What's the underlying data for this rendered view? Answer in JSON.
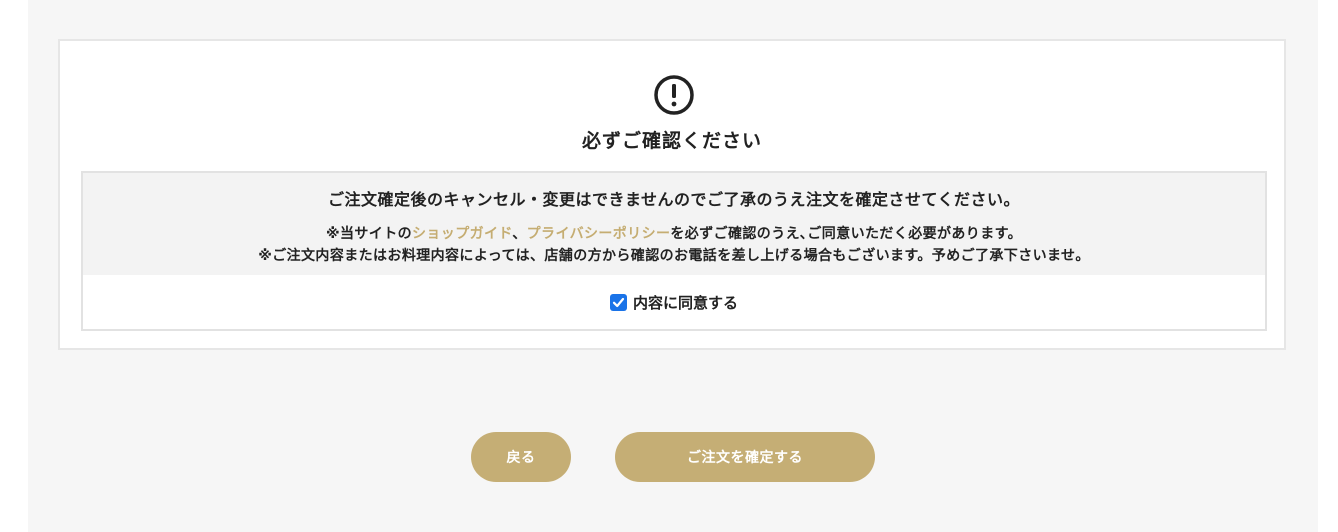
{
  "notice": {
    "icon": "exclamation-circle-icon",
    "title": "必ずご確認ください",
    "main_warning": "ご注文確定後のキャンセル・変更はできませんのでご了承のうえ注文を確定させてください。",
    "line1": {
      "prefix": "※当サイトの",
      "link1": "ショップガイド",
      "separator": "、",
      "link2": "プライバシーポリシー",
      "suffix": "を必ずご確認のうえ､ご同意いただく必要があります。"
    },
    "line2": "※ご注文内容またはお料理内容によっては、店舗の方から確認のお電話を差し上げる場合もございます。予めご了承下さいませ。",
    "agree_label": "内容に同意する",
    "agree_checked": true
  },
  "buttons": {
    "back_label": "戻る",
    "confirm_label": "ご注文を確定する"
  },
  "colors": {
    "accent": "#c5ae75",
    "link": "#c5ad72",
    "checkbox": "#1a73e8",
    "background": "#f6f6f6"
  }
}
